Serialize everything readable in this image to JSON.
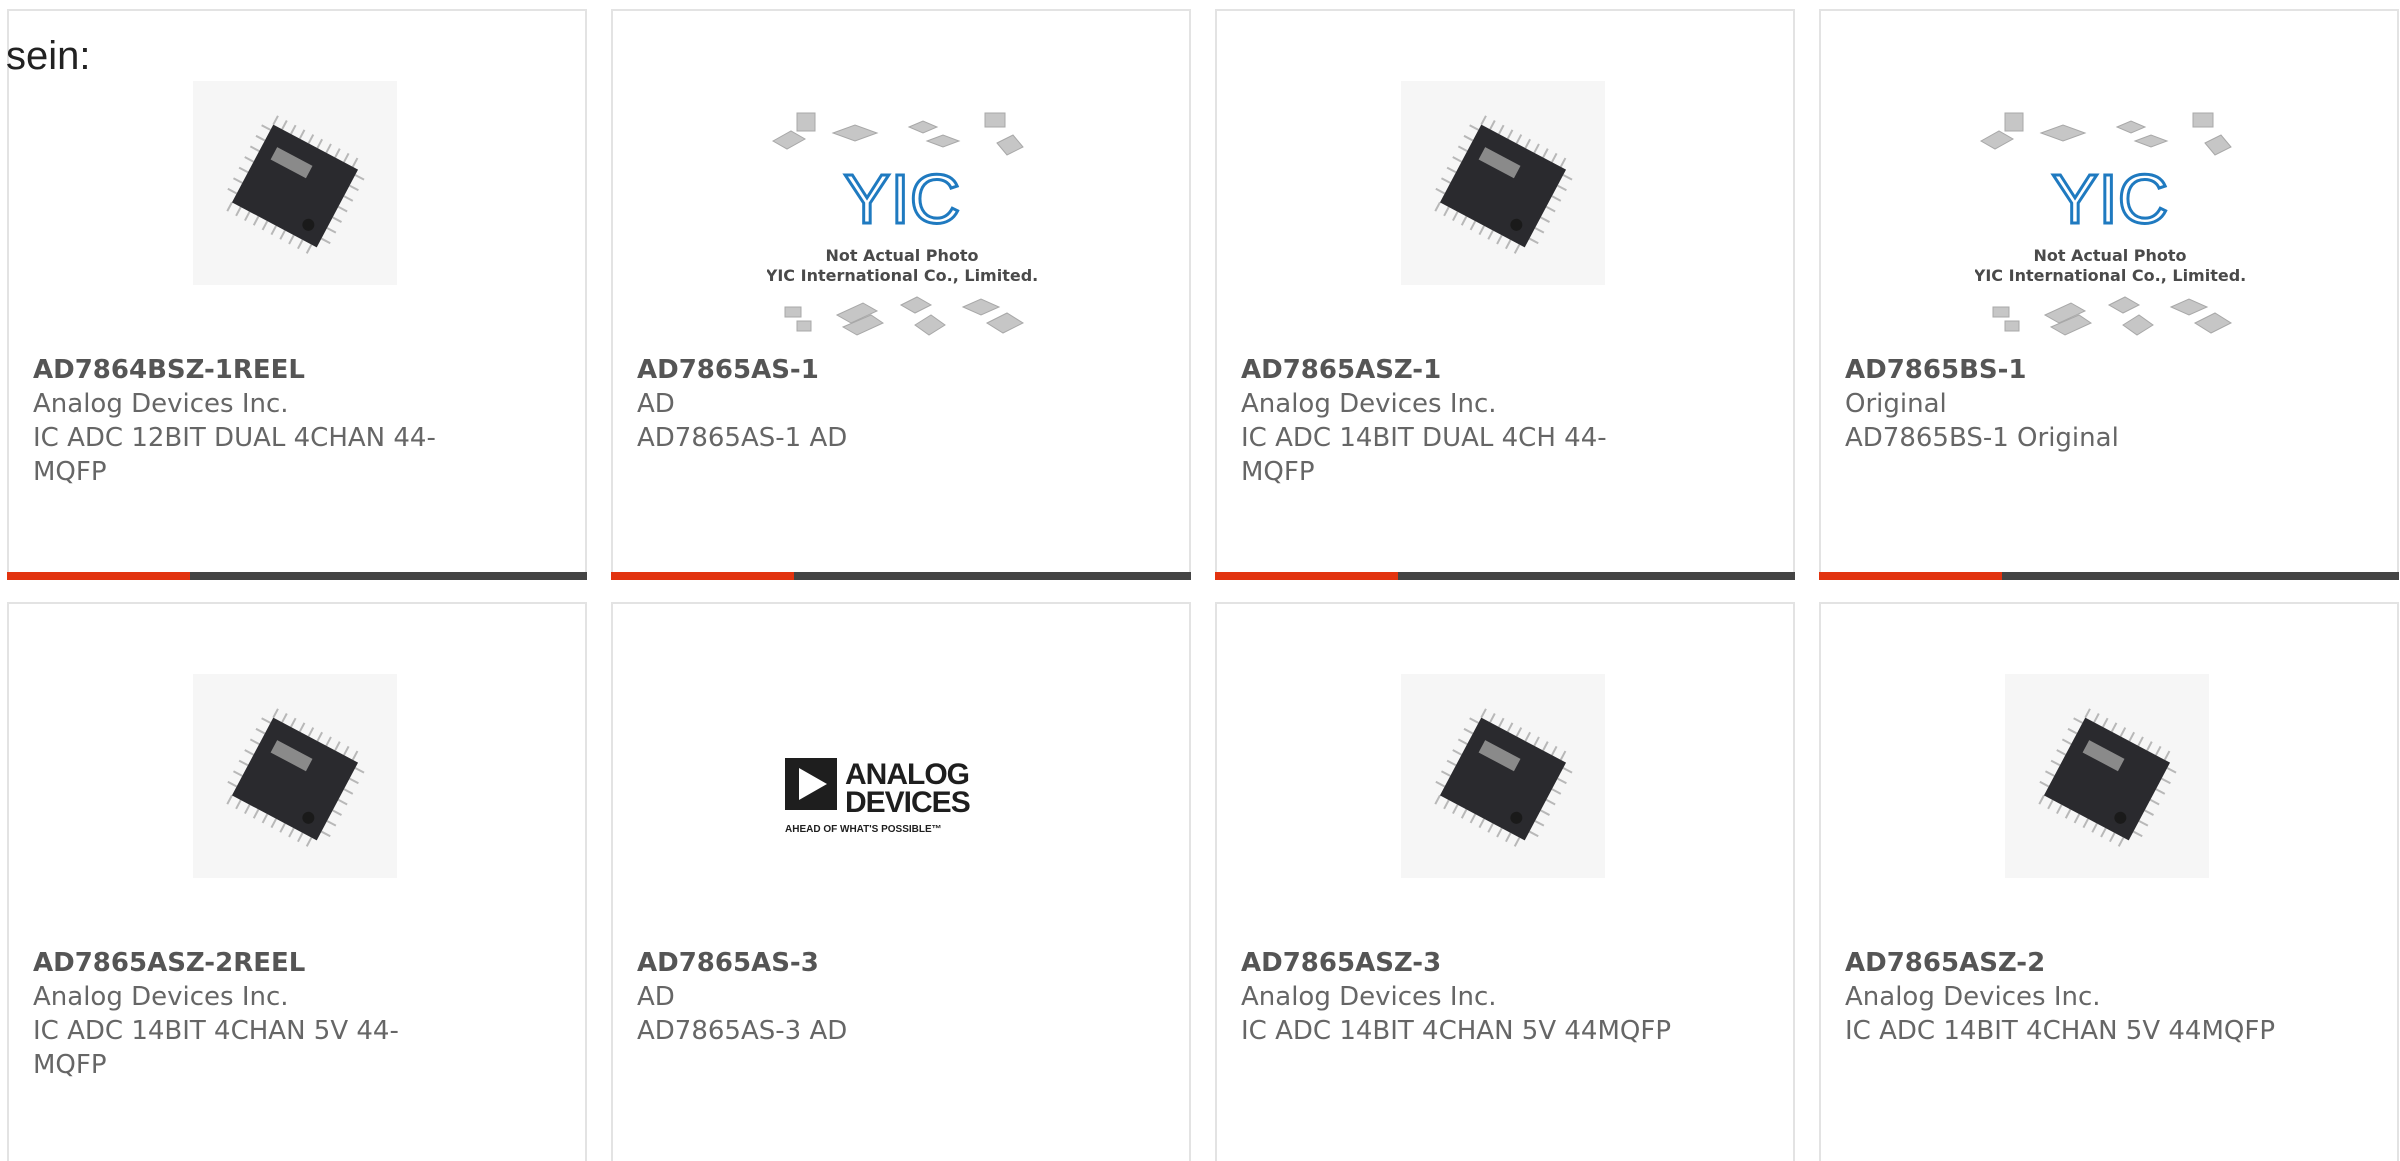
{
  "intro": "sein:",
  "products": [
    {
      "part": "AD7864BSZ-1REEL",
      "manufacturer": "Analog Devices Inc.",
      "description": "IC ADC 12BIT DUAL 4CHAN 44-MQFP",
      "image": "chip-icon"
    },
    {
      "part": "AD7865AS-1",
      "manufacturer": "AD",
      "description": "AD7865AS-1 AD",
      "image": "placeholder-photo-icon"
    },
    {
      "part": "AD7865ASZ-1",
      "manufacturer": "Analog Devices Inc.",
      "description": "IC ADC 14BIT DUAL 4CH 44-MQFP",
      "image": "chip-icon"
    },
    {
      "part": "AD7865BS-1",
      "manufacturer": "Original",
      "description": "AD7865BS-1 Original",
      "image": "placeholder-photo-icon"
    },
    {
      "part": "AD7865ASZ-2REEL",
      "manufacturer": "Analog Devices Inc.",
      "description": "IC ADC 14BIT 4CHAN 5V 44-MQFP",
      "image": "chip-icon"
    },
    {
      "part": "AD7865AS-3",
      "manufacturer": "AD",
      "description": "AD7865AS-3 AD",
      "image": "brand-logo-icon"
    },
    {
      "part": "AD7865ASZ-3",
      "manufacturer": "Analog Devices Inc.",
      "description": "IC ADC 14BIT 4CHAN 5V 44MQFP",
      "image": "chip-icon"
    },
    {
      "part": "AD7865ASZ-2",
      "manufacturer": "Analog Devices Inc.",
      "description": "IC ADC 14BIT 4CHAN 5V 44MQFP",
      "image": "chip-icon"
    }
  ],
  "placeholder": {
    "line1": "Not Actual Photo",
    "line2": "YIC International Co., Limited.",
    "mark": "YIC"
  },
  "brand_logo": {
    "line1": "ANALOG",
    "line2": "DEVICES",
    "tagline": "AHEAD OF WHAT'S POSSIBLE™"
  },
  "colors": {
    "accent": "#e2330f",
    "bar": "#444444",
    "border": "#e3e3e3",
    "text": "#666666"
  }
}
